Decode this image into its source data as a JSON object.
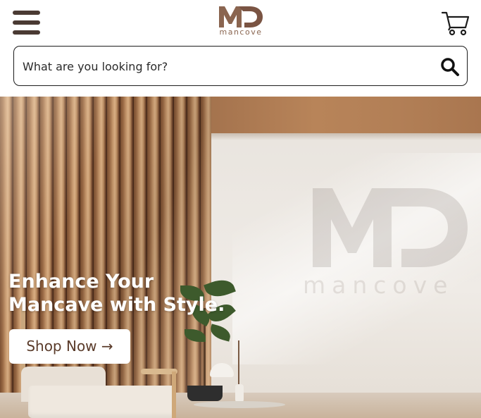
{
  "header": {
    "menu_icon": "hamburger-menu-icon",
    "logo": {
      "monogram": "MD",
      "wordmark": "mancove"
    },
    "cart_icon": "shopping-cart-icon"
  },
  "search": {
    "placeholder": "What are you looking for?",
    "value": "",
    "icon": "search-icon"
  },
  "hero": {
    "title_line1": "Enhance Your",
    "title_line2": "Mancave with Style.",
    "cta_label": "Shop Now →",
    "watermark": {
      "monogram": "MD",
      "wordmark": "mancove"
    }
  },
  "colors": {
    "brand_brown": "#8a6550",
    "dark_icon": "#4a3a33",
    "cta_text": "#5a3b2a",
    "hero_text": "#ffffff"
  }
}
